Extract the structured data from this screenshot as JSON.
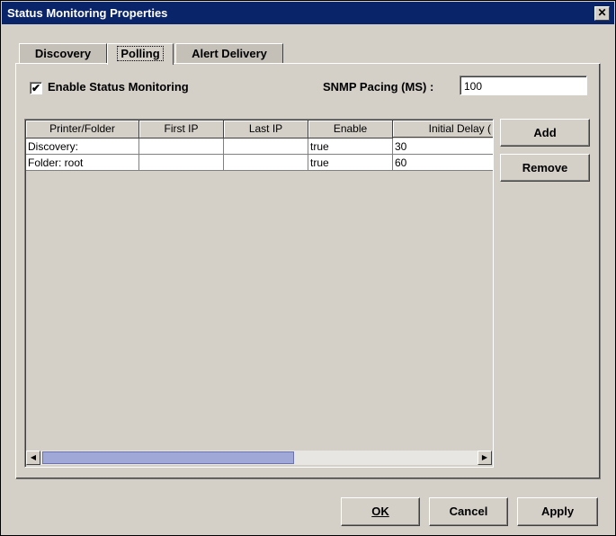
{
  "window": {
    "title": "Status Monitoring Properties"
  },
  "tabs": [
    {
      "label": "Discovery"
    },
    {
      "label": "Polling"
    },
    {
      "label": "Alert Delivery"
    }
  ],
  "enable_status": {
    "label": "Enable Status Monitoring",
    "checked": true,
    "mark": "✔"
  },
  "snmp": {
    "label": "SNMP Pacing (MS) :",
    "value": "100"
  },
  "table": {
    "headers": [
      "Printer/Folder",
      "First IP",
      "Last IP",
      "Enable",
      "Initial Delay ("
    ],
    "rows": [
      [
        "Discovery:",
        "",
        "",
        "true",
        "30"
      ],
      [
        "Folder: root",
        "",
        "",
        "true",
        "60"
      ]
    ]
  },
  "side_buttons": {
    "add": "Add",
    "remove": "Remove"
  },
  "footer_buttons": {
    "ok": "OK",
    "cancel": "Cancel",
    "apply": "Apply"
  },
  "scroll": {
    "left_arrow": "◀",
    "right_arrow": "▶"
  }
}
